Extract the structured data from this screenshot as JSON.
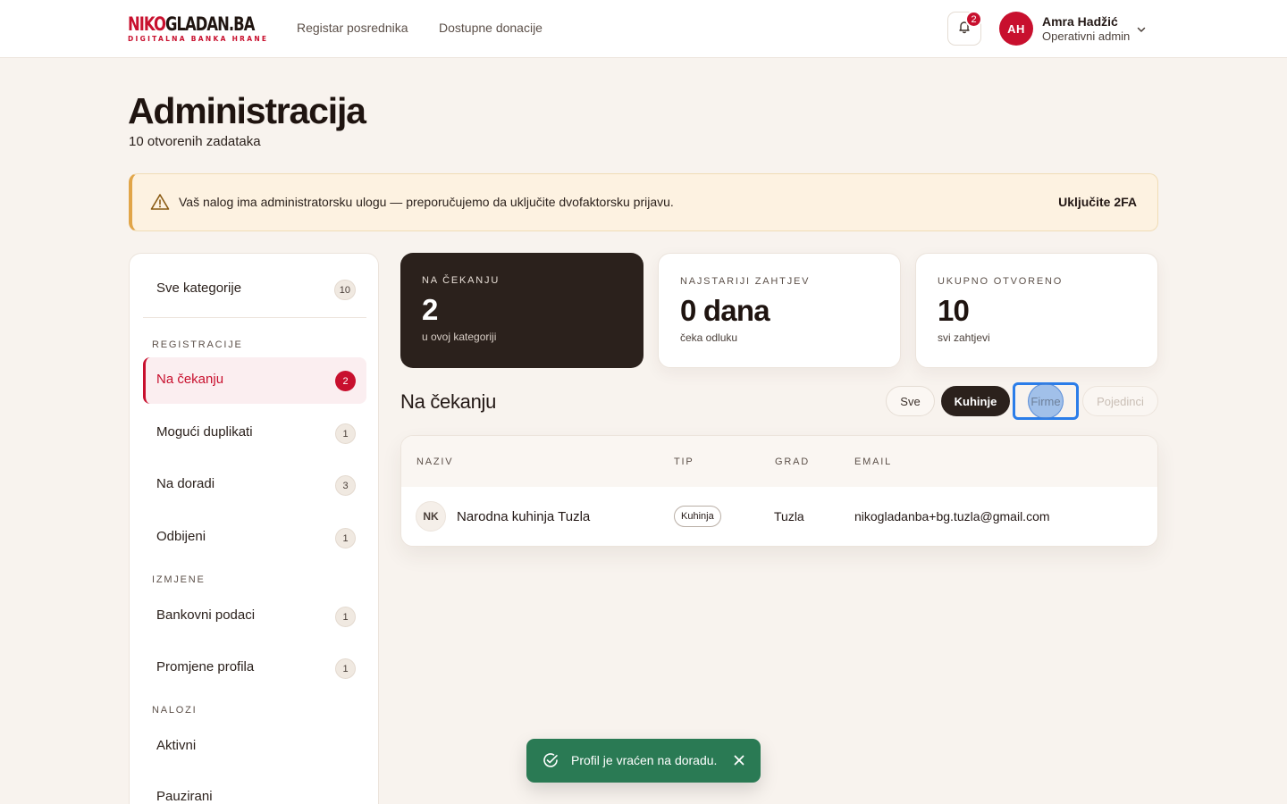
{
  "header": {
    "logo": {
      "part1": "NIKO",
      "part2": "GLADAN.BA",
      "tagline": "DIGITALNA BANKA HRANE"
    },
    "nav": [
      "Registar posrednika",
      "Dostupne donacije"
    ],
    "notifications_count": "2",
    "user": {
      "initials": "AH",
      "name": "Amra Hadžić",
      "role": "Operativni admin"
    }
  },
  "page": {
    "title": "Administracija",
    "subtitle": "10 otvorenih zadataka"
  },
  "alert": {
    "text": "Vaš nalog ima administratorsku ulogu — preporučujemo da uključite dvofaktorsku prijavu.",
    "action": "Uključite 2FA"
  },
  "sidebar": {
    "all": {
      "label": "Sve kategorije",
      "count": "10"
    },
    "sections": [
      {
        "title": "REGISTRACIJE",
        "items": [
          {
            "label": "Na čekanju",
            "count": "2",
            "active": true
          },
          {
            "label": "Mogući duplikati",
            "count": "1"
          },
          {
            "label": "Na doradi",
            "count": "3"
          },
          {
            "label": "Odbijeni",
            "count": "1"
          }
        ]
      },
      {
        "title": "IZMJENE",
        "items": [
          {
            "label": "Bankovni podaci",
            "count": "1"
          },
          {
            "label": "Promjene profila",
            "count": "1"
          }
        ]
      },
      {
        "title": "NALOZI",
        "items": [
          {
            "label": "Aktivni"
          },
          {
            "label": "Pauzirani"
          }
        ]
      }
    ]
  },
  "stats": [
    {
      "label": "NA ČEKANJU",
      "value": "2",
      "hint": "u ovoj kategoriji"
    },
    {
      "label": "NAJSTARIJI ZAHTJEV",
      "value": "0 dana",
      "hint": "čeka odluku"
    },
    {
      "label": "UKUPNO OTVORENO",
      "value": "10",
      "hint": "svi zahtjevi"
    }
  ],
  "list": {
    "title": "Na čekanju",
    "filters": [
      "Sve",
      "Kuhinje",
      "Firme",
      "Pojedinci"
    ],
    "active_filter": "Kuhinje",
    "columns": [
      "NAZIV",
      "TIP",
      "GRAD",
      "EMAIL"
    ],
    "rows": [
      {
        "initials": "NK",
        "name": "Narodna kuhinja Tuzla",
        "type": "Kuhinja",
        "city": "Tuzla",
        "email": "nikogladanba+bg.tuzla@gmail.com"
      }
    ]
  },
  "toast": {
    "text": "Profil je vraćen na doradu."
  },
  "colors": {
    "brand": "#c8102e",
    "dark": "#2b211c",
    "success": "#2a7a54",
    "background": "#f8f3ee"
  }
}
